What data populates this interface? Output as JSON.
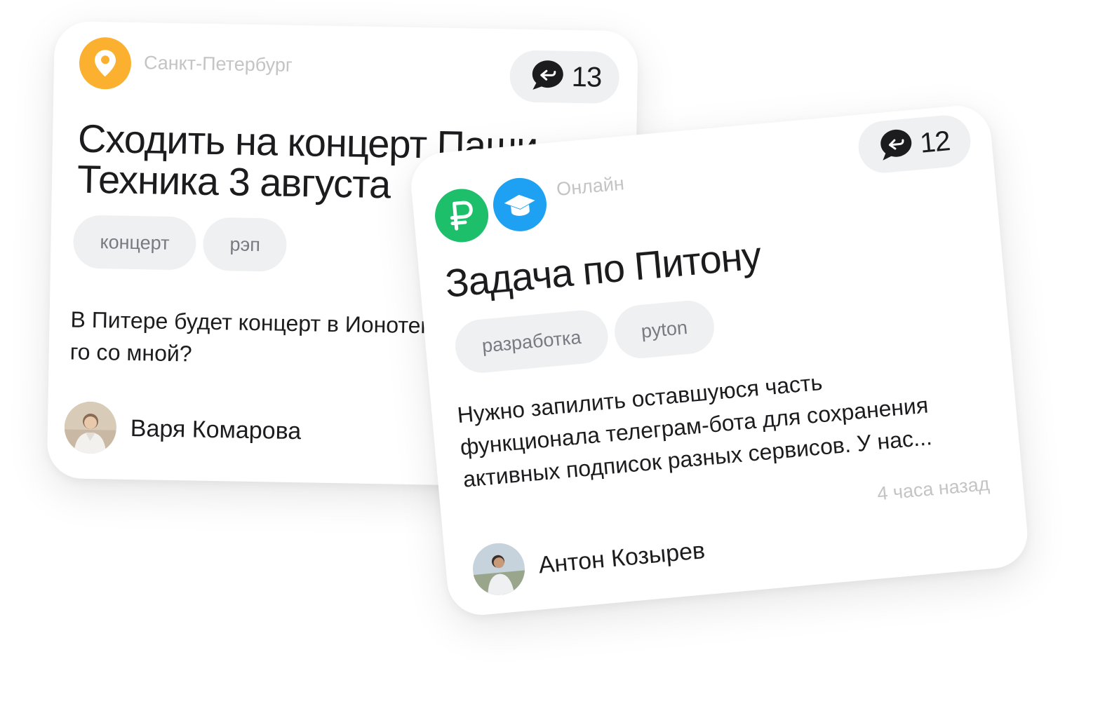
{
  "card1": {
    "location": "Санкт-Петербург",
    "reply_count": "13",
    "title_line1": "Сходить на концерт Паши",
    "title_line2": "Техника 3 августа",
    "tags": [
      "концерт",
      "рэп"
    ],
    "desc_line1": "В Питере будет концерт в Ионотеке",
    "desc_line2": "го со мной?",
    "author": "Варя Комарова",
    "icons": {
      "location": "location-pin-icon",
      "reply": "reply-bubble-icon"
    },
    "colors": {
      "location_icon": "#fbb030"
    }
  },
  "card2": {
    "location": "Онлайн",
    "reply_count": "12",
    "title": "Задача по Питону",
    "tags": [
      "разработка",
      "pyton"
    ],
    "desc_line1": "Нужно запилить оставшуюся часть",
    "desc_line2": "функционала телеграм-бота для сохранения",
    "desc_line3": "активных подписок разных сервисов. У нас...",
    "time": "4 часа назад",
    "author": "Антон Козырев",
    "icons": {
      "money": "ruble-icon",
      "education": "graduation-cap-icon",
      "reply": "reply-bubble-icon"
    },
    "colors": {
      "money_icon": "#1dbf6b",
      "education_icon": "#1ea1f2"
    }
  }
}
